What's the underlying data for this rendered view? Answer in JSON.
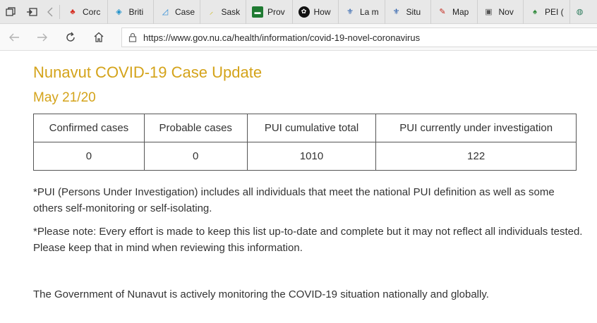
{
  "tabs": [
    {
      "label": "Corc",
      "icon": "canada-flag-icon",
      "color": "#d52b1e",
      "glyph": "♣"
    },
    {
      "label": "Briti",
      "icon": "bc-icon",
      "color": "#1a8fc9",
      "glyph": "◈"
    },
    {
      "label": "Case",
      "icon": "chart-icon",
      "color": "#2d8bd6",
      "glyph": "◿"
    },
    {
      "label": "Sask",
      "icon": "sask-icon",
      "color": "#c9b400",
      "glyph": "⸝"
    },
    {
      "label": "Prov",
      "icon": "manitoba-icon",
      "color": "#1f7a32",
      "glyph": "▬"
    },
    {
      "label": "How",
      "icon": "ontario-icon",
      "color": "#111111",
      "glyph": "✿"
    },
    {
      "label": "La m",
      "icon": "quebec-icon",
      "color": "#1c55a8",
      "glyph": "⚜"
    },
    {
      "label": "Situ",
      "icon": "quebec-icon-2",
      "color": "#1c55a8",
      "glyph": "⚜"
    },
    {
      "label": "Map",
      "icon": "map-icon",
      "color": "#c4281c",
      "glyph": "✎"
    },
    {
      "label": "Nov",
      "icon": "ns-icon",
      "color": "#555555",
      "glyph": "▣"
    },
    {
      "label": "PEI (",
      "icon": "pei-icon",
      "color": "#2f8a3a",
      "glyph": "♠"
    },
    {
      "label": "",
      "icon": "globe-icon",
      "color": "#2a7a5a",
      "glyph": "◍"
    }
  ],
  "url": "https://www.gov.nu.ca/health/information/covid-19-novel-coronavirus",
  "page": {
    "title": "Nunavut COVID-19 Case Update",
    "date": "May 21/20",
    "table": {
      "headers": [
        "Confirmed cases",
        "Probable cases",
        "PUI cumulative total",
        "PUI currently under investigation"
      ],
      "values": [
        "0",
        "0",
        "1010",
        "122"
      ]
    },
    "note_pui": "*PUI (Persons Under Investigation) includes all individuals that meet the national PUI definition as well as some others self-monitoring or self-isolating.",
    "note_please": "*Please note: Every effort is made to keep this list up-to-date and complete but it may not reflect all individuals tested. Please keep that in mind when reviewing this information.",
    "monitoring": "The Government of Nunavut is actively monitoring the COVID-19 situation nationally and globally."
  }
}
